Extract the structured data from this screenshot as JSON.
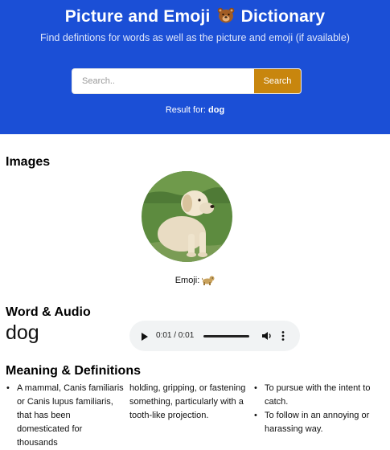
{
  "header": {
    "title_part1": "Picture and Emoji",
    "title_part2": "Dictionary",
    "subtitle": "Find defintions for words as well as the picture and emoji (if available)"
  },
  "search": {
    "placeholder": "Search..",
    "value": "",
    "button_label": "Search"
  },
  "result": {
    "label": "Result for:",
    "word": "dog"
  },
  "images_section": {
    "heading": "Images",
    "emoji_label": "Emoji:"
  },
  "word_audio": {
    "heading": "Word & Audio",
    "word": "dog",
    "audio_time": "0:01 / 0:01"
  },
  "meaning": {
    "heading": "Meaning & Definitions",
    "col1": [
      "A mammal, Canis familiaris or Canis lupus familiaris, that has been domesticated for thousands"
    ],
    "col2_text": "holding, gripping, or fastening something, particularly with a tooth-like projection.",
    "col3": [
      "To pursue with the intent to catch.",
      "To follow in an annoying or harassing way."
    ]
  },
  "colors": {
    "header_bg": "#1b4fd6",
    "search_button": "#c8860e",
    "audio_bg": "#f1f3f4"
  },
  "icons": [
    "bear-emoji-icon",
    "dog-emoji-icon",
    "play-icon",
    "volume-icon",
    "more-vertical-icon"
  ]
}
